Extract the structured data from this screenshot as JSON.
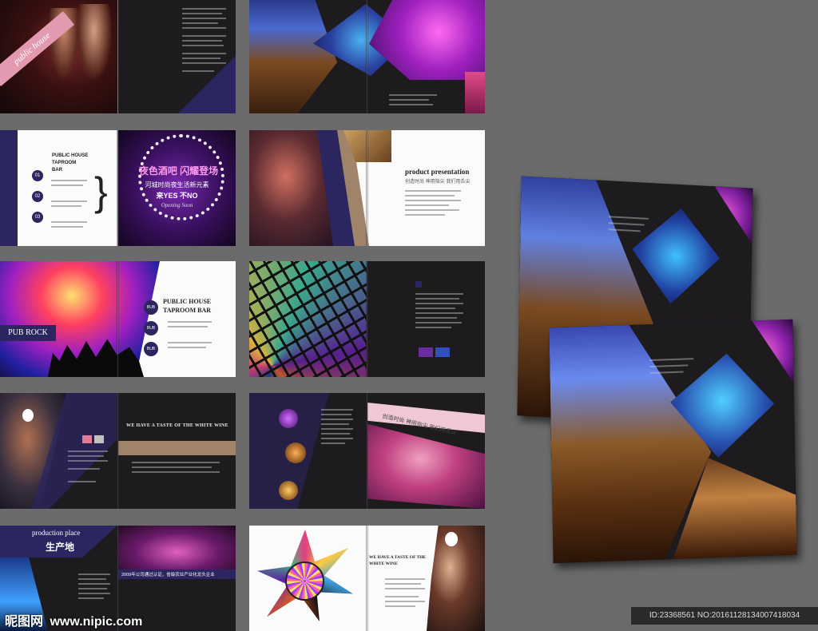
{
  "spreads": {
    "s1": {
      "ribbon": "public house"
    },
    "s3": {
      "heading_lines": [
        "PUBLIC HOUSE",
        "TAPROOM",
        "BAR"
      ],
      "numbers": [
        "01",
        "02",
        "03"
      ],
      "cn_title": "夜色酒吧  闪耀登场",
      "cn_sub": "河城时尚夜生活新元素",
      "cn_sub2": "来YES  不NO",
      "opening": "Opening Soon"
    },
    "s4": {
      "title": "product presentation",
      "subtitle": "创造时尚 神用指尖 我们用舌尖"
    },
    "s5": {
      "left_label": "PUB ROCK",
      "heading_lines": [
        "PUBLIC HOUSE",
        "TAPROOM BAR"
      ],
      "bubbles": [
        "BUB",
        "BUB",
        "BUB"
      ]
    },
    "s7": {
      "heading": "WE HAVE A TASTE  OF THE WHITE WINE"
    },
    "s8": {
      "banner": "创造时尚 神用指尖 我们用舌尖"
    },
    "s9": {
      "title_en": "production place",
      "title_cn": "生产地",
      "caption": "2009年公司通过认证，省级农业产业化龙头企业"
    },
    "s10": {
      "heading": "WE HAVE A TASTE OF THE WHITE WINE"
    }
  },
  "watermark": {
    "logo": "昵图网",
    "url": "www.nipic.com",
    "id_text": "ID:23368561 NO:20161128134007418034"
  },
  "colors": {
    "background": "#6b6b6b",
    "dark_page": "#1e1b1f",
    "navy": "#2b2560",
    "pink": "#e07a9a",
    "purple": "#6a2ca0"
  }
}
